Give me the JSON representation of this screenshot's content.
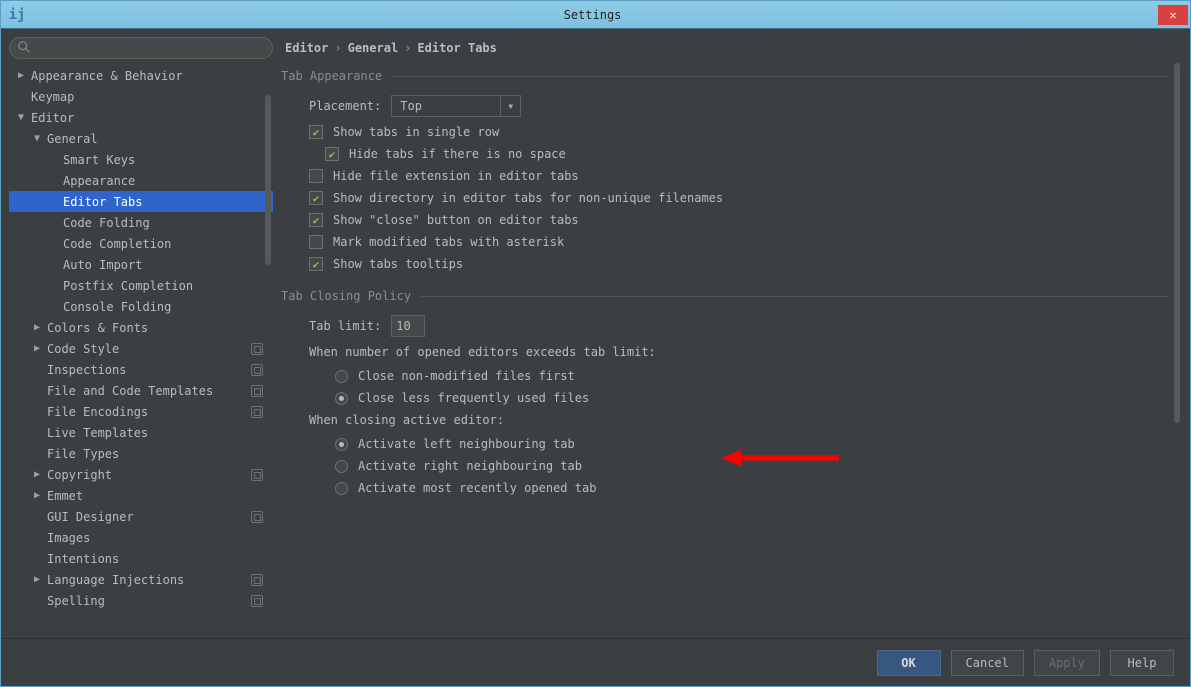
{
  "window": {
    "title": "Settings",
    "close_glyph": "✕",
    "app_glyph": "ij"
  },
  "search": {
    "placeholder": ""
  },
  "breadcrumb": [
    "Editor",
    "General",
    "Editor Tabs"
  ],
  "sidebar": {
    "items": [
      {
        "label": "Appearance & Behavior",
        "level": 0,
        "disclosure": "right",
        "proj": false
      },
      {
        "label": "Keymap",
        "level": 0,
        "disclosure": "none",
        "proj": false
      },
      {
        "label": "Editor",
        "level": 0,
        "disclosure": "down",
        "proj": false
      },
      {
        "label": "General",
        "level": 1,
        "disclosure": "down",
        "proj": false
      },
      {
        "label": "Smart Keys",
        "level": 2,
        "disclosure": "none",
        "proj": false
      },
      {
        "label": "Appearance",
        "level": 2,
        "disclosure": "none",
        "proj": false
      },
      {
        "label": "Editor Tabs",
        "level": 2,
        "disclosure": "none",
        "proj": false,
        "selected": true
      },
      {
        "label": "Code Folding",
        "level": 2,
        "disclosure": "none",
        "proj": false
      },
      {
        "label": "Code Completion",
        "level": 2,
        "disclosure": "none",
        "proj": false
      },
      {
        "label": "Auto Import",
        "level": 2,
        "disclosure": "none",
        "proj": false
      },
      {
        "label": "Postfix Completion",
        "level": 2,
        "disclosure": "none",
        "proj": false
      },
      {
        "label": "Console Folding",
        "level": 2,
        "disclosure": "none",
        "proj": false
      },
      {
        "label": "Colors & Fonts",
        "level": 1,
        "disclosure": "right",
        "proj": false
      },
      {
        "label": "Code Style",
        "level": 1,
        "disclosure": "right",
        "proj": true
      },
      {
        "label": "Inspections",
        "level": 1,
        "disclosure": "none",
        "proj": true
      },
      {
        "label": "File and Code Templates",
        "level": 1,
        "disclosure": "none",
        "proj": true
      },
      {
        "label": "File Encodings",
        "level": 1,
        "disclosure": "none",
        "proj": true
      },
      {
        "label": "Live Templates",
        "level": 1,
        "disclosure": "none",
        "proj": false
      },
      {
        "label": "File Types",
        "level": 1,
        "disclosure": "none",
        "proj": false
      },
      {
        "label": "Copyright",
        "level": 1,
        "disclosure": "right",
        "proj": true
      },
      {
        "label": "Emmet",
        "level": 1,
        "disclosure": "right",
        "proj": false
      },
      {
        "label": "GUI Designer",
        "level": 1,
        "disclosure": "none",
        "proj": true
      },
      {
        "label": "Images",
        "level": 1,
        "disclosure": "none",
        "proj": false
      },
      {
        "label": "Intentions",
        "level": 1,
        "disclosure": "none",
        "proj": false
      },
      {
        "label": "Language Injections",
        "level": 1,
        "disclosure": "right",
        "proj": true
      },
      {
        "label": "Spelling",
        "level": 1,
        "disclosure": "none",
        "proj": true
      }
    ]
  },
  "groups": {
    "tab_appearance": {
      "title": "Tab Appearance",
      "placement_label": "Placement:",
      "placement_value": "Top",
      "checks": [
        {
          "label": "Show tabs in single row",
          "checked": true,
          "indent": 0
        },
        {
          "label": "Hide tabs if there is no space",
          "checked": true,
          "indent": 1
        },
        {
          "label": "Hide file extension in editor tabs",
          "checked": false,
          "indent": 0
        },
        {
          "label": "Show directory in editor tabs for non-unique filenames",
          "checked": true,
          "indent": 0
        },
        {
          "label": "Show \"close\" button on editor tabs",
          "checked": true,
          "indent": 0
        },
        {
          "label": "Mark modified tabs with asterisk",
          "checked": false,
          "indent": 0
        },
        {
          "label": "Show tabs tooltips",
          "checked": true,
          "indent": 0
        }
      ]
    },
    "tab_closing": {
      "title": "Tab Closing Policy",
      "tab_limit_label": "Tab limit:",
      "tab_limit_value": "10",
      "exceeds_label": "When number of opened editors exceeds tab limit:",
      "exceeds_options": [
        {
          "label": "Close non-modified files first",
          "checked": false
        },
        {
          "label": "Close less frequently used files",
          "checked": true
        }
      ],
      "closing_active_label": "When closing active editor:",
      "closing_active_options": [
        {
          "label": "Activate left neighbouring tab",
          "checked": true
        },
        {
          "label": "Activate right neighbouring tab",
          "checked": false
        },
        {
          "label": "Activate most recently opened tab",
          "checked": false
        }
      ]
    }
  },
  "buttons": {
    "ok": "OK",
    "cancel": "Cancel",
    "apply": "Apply",
    "help": "Help"
  }
}
